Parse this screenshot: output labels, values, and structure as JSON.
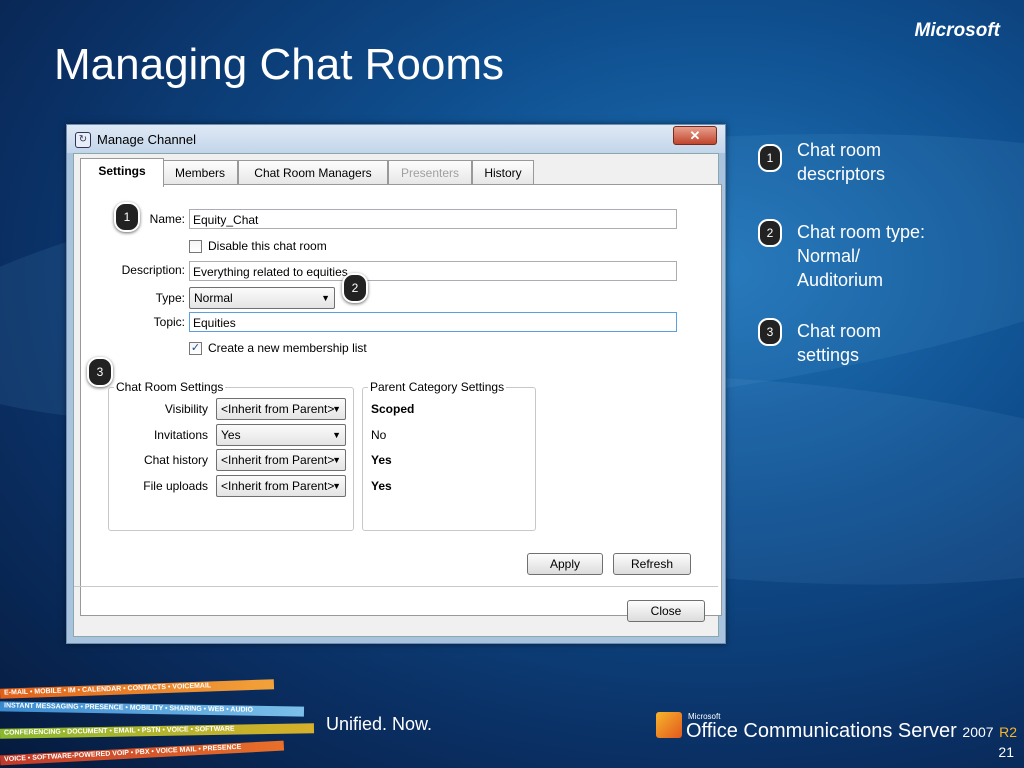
{
  "slide": {
    "title": "Managing Chat Rooms",
    "brand": "Microsoft",
    "page_number": "21",
    "tagline": "Unified. Now.",
    "product_small": "Microsoft",
    "product_name": "Office Communications Server",
    "product_year": "2007",
    "product_r2": "R2"
  },
  "window": {
    "title": "Manage Channel",
    "close_glyph": "✕",
    "tabs": [
      {
        "label": "Settings",
        "state": "active"
      },
      {
        "label": "Members",
        "state": "normal"
      },
      {
        "label": "Chat Room Managers",
        "state": "normal"
      },
      {
        "label": "Presenters",
        "state": "disabled"
      },
      {
        "label": "History",
        "state": "normal"
      }
    ],
    "name_label": "Name:",
    "name_value": "Equity_Chat",
    "disable_label": "Disable this chat room",
    "disable_checked": false,
    "description_label": "Description:",
    "description_value": "Everything related to equities",
    "type_label": "Type:",
    "type_value": "Normal",
    "topic_label": "Topic:",
    "topic_value": "Equities",
    "membership_label": "Create a new membership list",
    "membership_checked": true,
    "chat_room_settings": {
      "caption": "Chat Room Settings",
      "rows": [
        {
          "label": "Visibility",
          "value": "<Inherit from Parent>"
        },
        {
          "label": "Invitations",
          "value": "Yes"
        },
        {
          "label": "Chat history",
          "value": "<Inherit from Parent>"
        },
        {
          "label": "File uploads",
          "value": "<Inherit from Parent>"
        }
      ]
    },
    "parent_category_settings": {
      "caption": "Parent Category Settings",
      "values": [
        "Scoped",
        "No",
        "Yes",
        "Yes"
      ]
    },
    "apply_label": "Apply",
    "refresh_label": "Refresh",
    "close_label": "Close"
  },
  "callouts": [
    "1",
    "2",
    "3"
  ],
  "legend": [
    {
      "num": "1",
      "lines": [
        "Chat room",
        "descriptors"
      ]
    },
    {
      "num": "2",
      "lines": [
        "Chat room type:",
        "Normal/",
        "Auditorium"
      ]
    },
    {
      "num": "3",
      "lines": [
        "Chat room",
        "settings"
      ]
    }
  ],
  "ribbon_lines": [
    "E-MAIL • MOBILE • IM • CALENDAR • CONTACTS • VOICEMAIL",
    "INSTANT MESSAGING • PRESENCE • MOBILITY • SHARING • WEB • AUDIO",
    "CONFERENCING • DOCUMENT • EMAIL • PSTN • VOICE • SOFTWARE",
    "VOICE • SOFTWARE-POWERED VOIP • PBX • VOICE MAIL • PRESENCE"
  ],
  "colors": {
    "accent": "#1f74b8",
    "badge": "#222222",
    "logo_orange": "#f7b52c"
  }
}
